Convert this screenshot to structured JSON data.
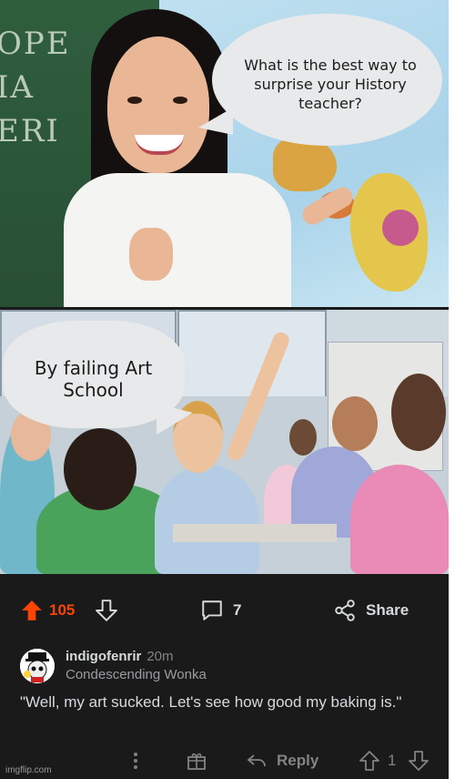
{
  "meme": {
    "panel1_bubble": "What is the best way to surprise your History teacher?",
    "panel1_board_text": "OPE\nIA\nERI",
    "panel2_bubble": "By failing Art School"
  },
  "post_actions": {
    "score": "105",
    "comment_count": "7",
    "share_label": "Share",
    "upvote_icon": "upvote-arrow-icon",
    "downvote_icon": "downvote-arrow-icon",
    "comment_icon": "comment-bubble-icon",
    "share_icon": "share-icon"
  },
  "comment": {
    "username": "indigofenrir",
    "time": "20m",
    "flair": "Condescending Wonka",
    "text": "\"Well, my art sucked. Let's see how good my baking is.\"",
    "reply_label": "Reply",
    "vote_count": "1"
  },
  "watermark": "imgflip.com",
  "colors": {
    "upvoted": "#ff4500",
    "background": "#1a1a1b",
    "text": "#d7dadc",
    "muted": "#818384"
  }
}
